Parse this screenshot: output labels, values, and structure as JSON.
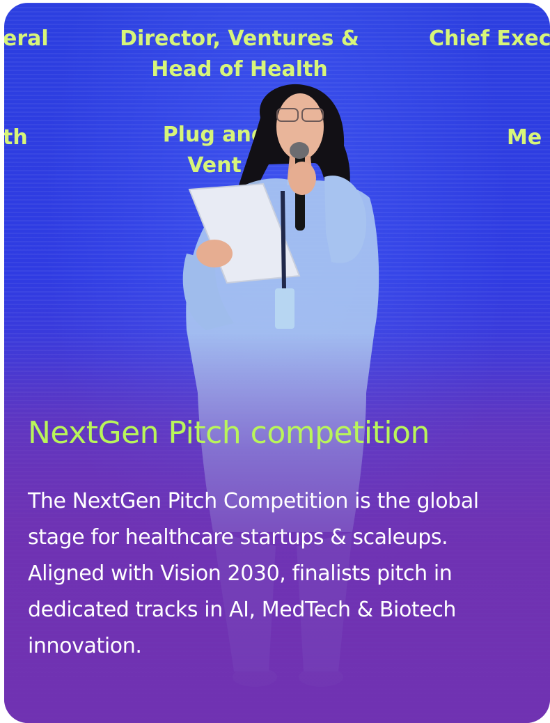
{
  "card": {
    "title": "NextGen Pitch competition",
    "description": "The NextGen Pitch Competition is the global stage for healthcare startups & scaleups. Aligned with Vision 2030, finalists pitch in dedicated tracks in AI, MedTech & Biotech innovation.",
    "colors": {
      "title": "#b9f55a",
      "description": "#ffffff",
      "background_top": "#2c3fe0",
      "background_bottom": "#6f33b2",
      "screen_text": "#d7f57a"
    }
  },
  "photo": {
    "screen_labels": [
      "eral",
      "Director, Ventures & Head of Health",
      "Chief Exec",
      "th",
      "Plug and Vent",
      "Me"
    ]
  }
}
